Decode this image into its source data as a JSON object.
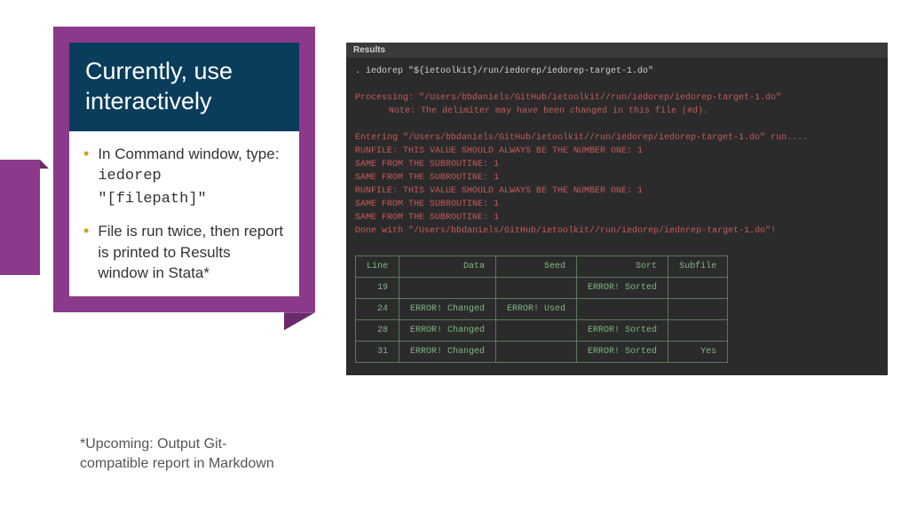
{
  "title": "Currently, use interactively",
  "bullets": {
    "b1_text": "In Command window, type: ",
    "b1_code1": "iedorep ",
    "b1_code2": "\"[filepath]\"",
    "b2_text": "File is run twice, then report is printed to Results window in Stata*"
  },
  "footnote": "*Upcoming: Output Git-compatible report in Markdown",
  "terminal": {
    "header": "Results",
    "cmd": ". iedorep \"${ietoolkit}/run/iedorep/iedorep-target-1.do\"",
    "proc": "Processing: \"/Users/bbdaniels/GitHub/ietoolkit//run/iedorep/iedorep-target-1.do\"",
    "note": "Note: The delimiter may have been changed in this file (#d).",
    "entering": "Entering \"/Users/bbdaniels/GitHub/ietoolkit//run/iedorep/iedorep-target-1.do\" run....",
    "run1": "RUNFILE: THIS VALUE SHOULD ALWAYS BE THE NUMBER ONE: 1",
    "sub1": "SAME FROM THE SUBROUTINE: 1",
    "sub2": "SAME FROM THE SUBROUTINE: 1",
    "run2": "RUNFILE: THIS VALUE SHOULD ALWAYS BE THE NUMBER ONE: 1",
    "sub3": "SAME FROM THE SUBROUTINE: 1",
    "sub4": "SAME FROM THE SUBROUTINE: 1",
    "done": "Done with \"/Users/bbdaniels/GitHub/ietoolkit//run/iedorep/iedorep-target-1.do\"!"
  },
  "table": {
    "headers": [
      "Line",
      "Data",
      "Seed",
      "Sort",
      "Subfile"
    ],
    "rows": [
      {
        "line": "19",
        "data": "",
        "seed": "",
        "sort": "ERROR! Sorted",
        "subfile": ""
      },
      {
        "line": "24",
        "data": "ERROR! Changed",
        "seed": "ERROR! Used",
        "sort": "",
        "subfile": ""
      },
      {
        "line": "28",
        "data": "ERROR! Changed",
        "seed": "",
        "sort": "ERROR! Sorted",
        "subfile": ""
      },
      {
        "line": "31",
        "data": "ERROR! Changed",
        "seed": "",
        "sort": "ERROR! Sorted",
        "subfile": "Yes"
      }
    ]
  }
}
